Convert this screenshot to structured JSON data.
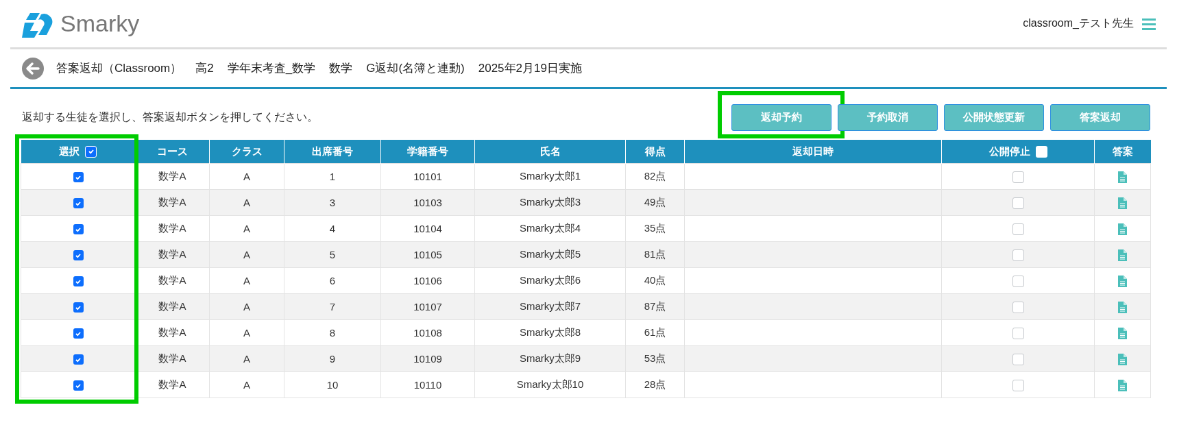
{
  "header": {
    "logo_text": "Smarky",
    "user": "classroom_テスト先生"
  },
  "breadcrumb": {
    "items": [
      "答案返却（Classroom）",
      "高2",
      "学年末考査_数学",
      "数学",
      "G返却(名簿と連動)",
      "2025年2月19日実施"
    ]
  },
  "instruction": "返却する生徒を選択し、答案返却ボタンを押してください。",
  "buttons": [
    {
      "label": "返却予約",
      "highlighted": true
    },
    {
      "label": "予約取消",
      "highlighted": false
    },
    {
      "label": "公開状態更新",
      "highlighted": false
    },
    {
      "label": "答案返却",
      "highlighted": false
    }
  ],
  "table": {
    "select_column_highlighted": true,
    "columns": [
      {
        "label": "選択",
        "kind": "checkbox",
        "checked": true
      },
      {
        "label": "コース",
        "kind": "text"
      },
      {
        "label": "クラス",
        "kind": "text"
      },
      {
        "label": "出席番号",
        "kind": "text"
      },
      {
        "label": "学籍番号",
        "kind": "text"
      },
      {
        "label": "氏名",
        "kind": "text"
      },
      {
        "label": "得点",
        "kind": "text"
      },
      {
        "label": "返却日時",
        "kind": "text"
      },
      {
        "label": "公開停止",
        "kind": "checkbox",
        "checked": false
      },
      {
        "label": "答案",
        "kind": "text"
      }
    ],
    "rows": [
      {
        "selected": true,
        "course": "数学A",
        "class": "A",
        "attendance_no": "1",
        "student_id": "10101",
        "name": "Smarky太郎1",
        "score": "82点",
        "return_datetime": "",
        "publish_stopped": false
      },
      {
        "selected": true,
        "course": "数学A",
        "class": "A",
        "attendance_no": "3",
        "student_id": "10103",
        "name": "Smarky太郎3",
        "score": "49点",
        "return_datetime": "",
        "publish_stopped": false
      },
      {
        "selected": true,
        "course": "数学A",
        "class": "A",
        "attendance_no": "4",
        "student_id": "10104",
        "name": "Smarky太郎4",
        "score": "35点",
        "return_datetime": "",
        "publish_stopped": false
      },
      {
        "selected": true,
        "course": "数学A",
        "class": "A",
        "attendance_no": "5",
        "student_id": "10105",
        "name": "Smarky太郎5",
        "score": "81点",
        "return_datetime": "",
        "publish_stopped": false
      },
      {
        "selected": true,
        "course": "数学A",
        "class": "A",
        "attendance_no": "6",
        "student_id": "10106",
        "name": "Smarky太郎6",
        "score": "40点",
        "return_datetime": "",
        "publish_stopped": false
      },
      {
        "selected": true,
        "course": "数学A",
        "class": "A",
        "attendance_no": "7",
        "student_id": "10107",
        "name": "Smarky太郎7",
        "score": "87点",
        "return_datetime": "",
        "publish_stopped": false
      },
      {
        "selected": true,
        "course": "数学A",
        "class": "A",
        "attendance_no": "8",
        "student_id": "10108",
        "name": "Smarky太郎8",
        "score": "61点",
        "return_datetime": "",
        "publish_stopped": false
      },
      {
        "selected": true,
        "course": "数学A",
        "class": "A",
        "attendance_no": "9",
        "student_id": "10109",
        "name": "Smarky太郎9",
        "score": "53点",
        "return_datetime": "",
        "publish_stopped": false
      },
      {
        "selected": true,
        "course": "数学A",
        "class": "A",
        "attendance_no": "10",
        "student_id": "10110",
        "name": "Smarky太郎10",
        "score": "28点",
        "return_datetime": "",
        "publish_stopped": false
      }
    ]
  }
}
